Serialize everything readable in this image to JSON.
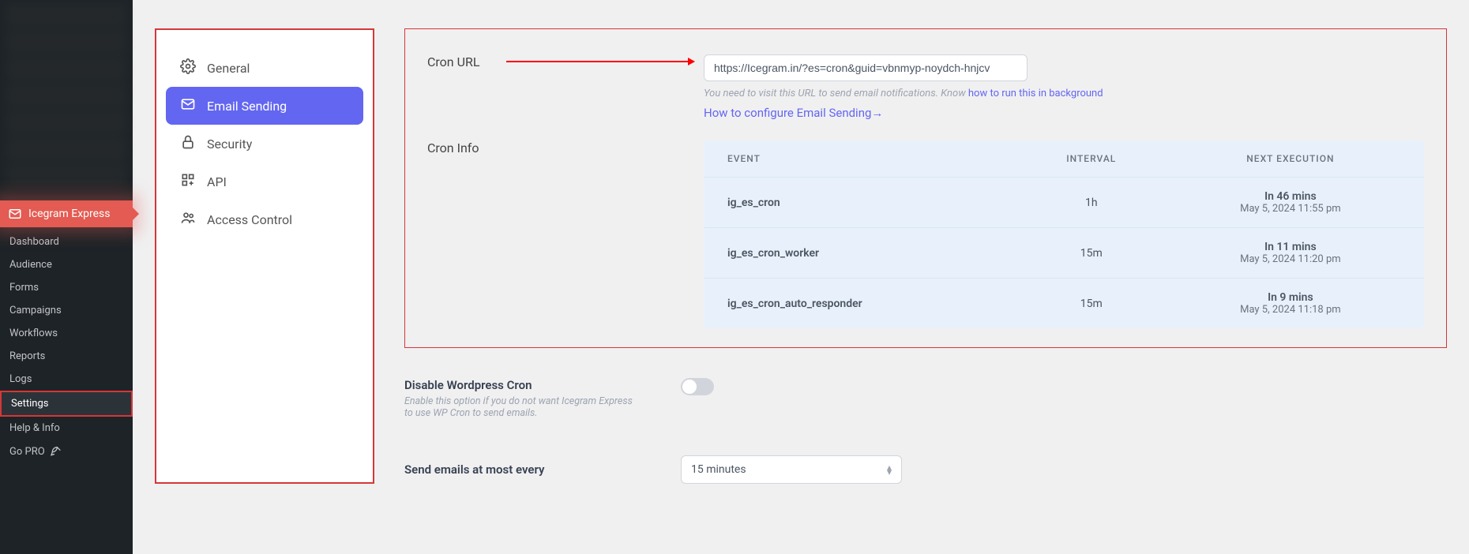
{
  "brand": "Icegram Express",
  "wpmenu": [
    {
      "label": "Dashboard",
      "active": false
    },
    {
      "label": "Audience",
      "active": false
    },
    {
      "label": "Forms",
      "active": false
    },
    {
      "label": "Campaigns",
      "active": false
    },
    {
      "label": "Workflows",
      "active": false
    },
    {
      "label": "Reports",
      "active": false
    },
    {
      "label": "Logs",
      "active": false
    },
    {
      "label": "Settings",
      "active": true
    },
    {
      "label": "Help & Info",
      "active": false
    },
    {
      "label": "Go PRO",
      "active": false,
      "gopro": true
    }
  ],
  "tabs": [
    {
      "label": "General",
      "icon": "gear"
    },
    {
      "label": "Email Sending",
      "icon": "mail",
      "active": true
    },
    {
      "label": "Security",
      "icon": "lock"
    },
    {
      "label": "API",
      "icon": "grid"
    },
    {
      "label": "Access Control",
      "icon": "users"
    }
  ],
  "cronurl": {
    "label": "Cron URL",
    "value": "https://Icegram.in/?es=cron&guid=vbnmyp-noydch-hnjcv",
    "help_pre": "You need to visit this URL to send email notifications. Know ",
    "help_link": "how to run this in background",
    "cfg_link": "How to configure Email Sending→"
  },
  "croninfo": {
    "label": "Cron Info",
    "headers": [
      "EVENT",
      "INTERVAL",
      "NEXT EXECUTION"
    ],
    "rows": [
      {
        "event": "ig_es_cron",
        "interval": "1h",
        "next": "In 46 mins",
        "date": "May 5, 2024 11:55 pm"
      },
      {
        "event": "ig_es_cron_worker",
        "interval": "15m",
        "next": "In 11 mins",
        "date": "May 5, 2024 11:20 pm"
      },
      {
        "event": "ig_es_cron_auto_responder",
        "interval": "15m",
        "next": "In 9 mins",
        "date": "May 5, 2024 11:18 pm"
      }
    ]
  },
  "disable": {
    "title": "Disable Wordpress Cron",
    "sub": "Enable this option if you do not want Icegram Express to use WP Cron to send emails."
  },
  "sendmost": {
    "label": "Send emails at most every",
    "value": "15 minutes"
  }
}
